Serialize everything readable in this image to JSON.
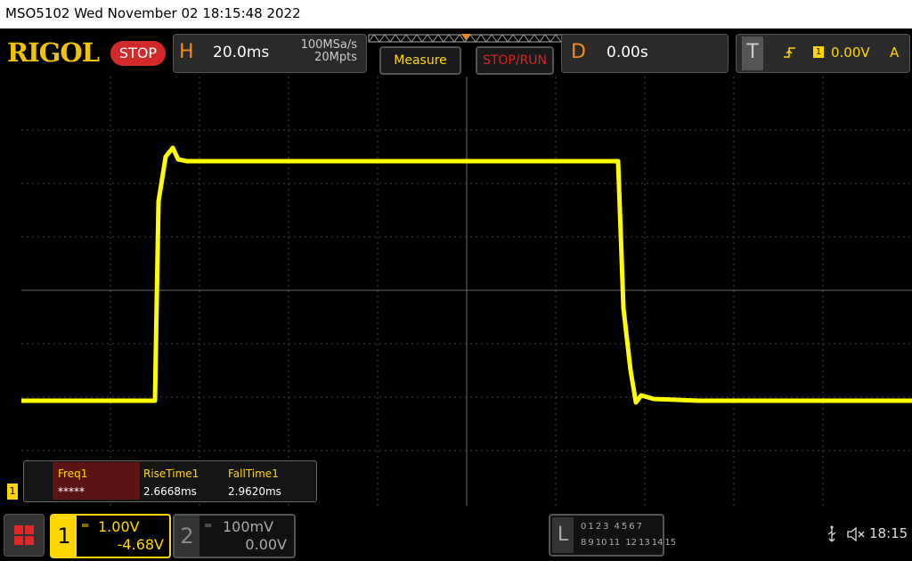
{
  "titlebar": {
    "text": "MSO5102  Wed November 02 18:15:48 2022"
  },
  "logo": "RIGOL",
  "run_state": "STOP",
  "horizontal": {
    "letter": "H",
    "timebase": "20.0ms",
    "sample_rate": "100MSa/s",
    "memory_depth": "20Mpts"
  },
  "buttons": {
    "measure": "Measure",
    "stop_run": "STOP/RUN"
  },
  "delay": {
    "letter": "D",
    "value": "0.00s"
  },
  "trigger": {
    "letter": "T",
    "source": "1",
    "level": "0.00V",
    "mode": "A"
  },
  "measurements": {
    "headers": [
      "Freq1",
      "RiseTime1",
      "FallTime1"
    ],
    "values": [
      "*****",
      "2.6668ms",
      "2.9620ms"
    ]
  },
  "ch1_marker": "1",
  "channels": [
    {
      "number": "1",
      "scale": "1.00V",
      "offset": "-4.68V",
      "color": "#ffff00"
    },
    {
      "number": "2",
      "scale": "100mV",
      "offset": "0.00V",
      "color": "#888888"
    }
  ],
  "logic": {
    "letter": "L",
    "row1": [
      "0",
      "1",
      "2",
      "3",
      "4",
      "5",
      "6",
      "7"
    ],
    "row2": [
      "8",
      "9",
      "10",
      "11",
      "12",
      "13",
      "14",
      "15"
    ]
  },
  "status": {
    "time": "18:15"
  },
  "colors": {
    "trace": "#ffff00",
    "accent_orange": "#f28a18",
    "stop_red": "#d22a2a",
    "logo_gold": "#f2c300"
  }
}
